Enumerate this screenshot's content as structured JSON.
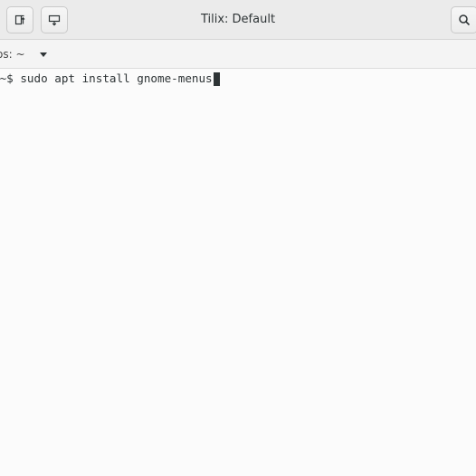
{
  "window": {
    "title": "Tilix: Default"
  },
  "headerbar": {
    "buttons": [
      {
        "name": "add-terminal-right",
        "icon": "split-right-icon"
      },
      {
        "name": "add-terminal-down",
        "icon": "split-down-icon"
      },
      {
        "name": "find",
        "icon": "search-icon"
      }
    ]
  },
  "session": {
    "title": "os: ~"
  },
  "terminal": {
    "prompt": ":~$ ",
    "command": "sudo apt install gnome-menus"
  },
  "colors": {
    "headerbar_bg": "#ebebeb",
    "terminal_bg": "#fbfbfb",
    "text": "#2e3436"
  }
}
